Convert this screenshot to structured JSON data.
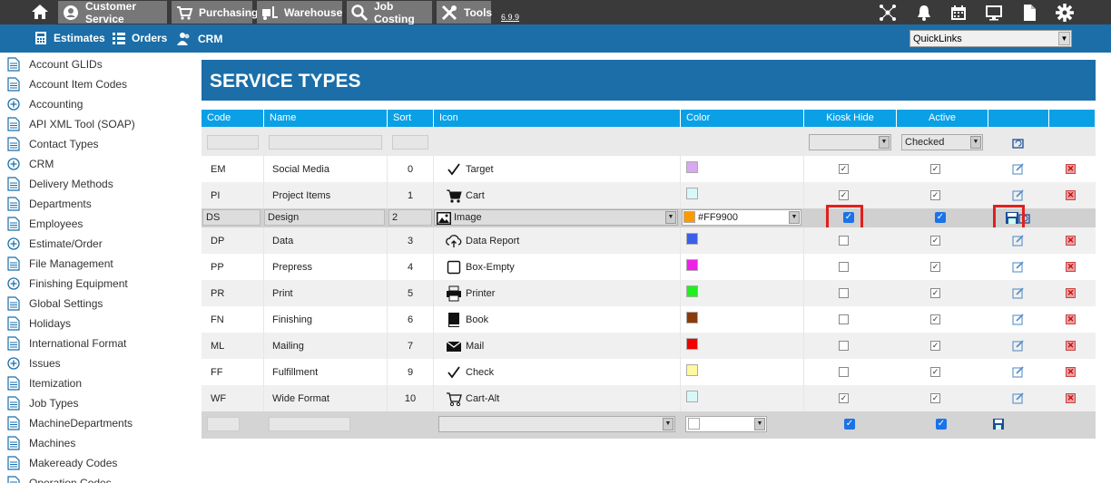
{
  "topnav": {
    "items": [
      {
        "label": "Customer Service"
      },
      {
        "label": "Purchasing"
      },
      {
        "label": "Warehouse"
      },
      {
        "label": "Job Costing"
      },
      {
        "label": "Tools"
      }
    ],
    "version": "6.9.9"
  },
  "subnav": {
    "items": [
      {
        "label": "Estimates"
      },
      {
        "label": "Orders"
      },
      {
        "label": "CRM"
      }
    ],
    "quicklinks": "QuickLinks"
  },
  "sidebar": {
    "items": [
      {
        "label": "Account GLIDs",
        "icon": "document-icon"
      },
      {
        "label": "Account Item Codes",
        "icon": "document-icon"
      },
      {
        "label": "Accounting",
        "icon": "plus-circle-icon"
      },
      {
        "label": "API XML Tool (SOAP)",
        "icon": "document-icon"
      },
      {
        "label": "Contact Types",
        "icon": "document-icon"
      },
      {
        "label": "CRM",
        "icon": "plus-circle-icon"
      },
      {
        "label": "Delivery Methods",
        "icon": "document-icon"
      },
      {
        "label": "Departments",
        "icon": "document-icon"
      },
      {
        "label": "Employees",
        "icon": "document-icon"
      },
      {
        "label": "Estimate/Order",
        "icon": "plus-circle-icon"
      },
      {
        "label": "File Management",
        "icon": "document-icon"
      },
      {
        "label": "Finishing Equipment",
        "icon": "plus-circle-icon"
      },
      {
        "label": "Global Settings",
        "icon": "document-icon"
      },
      {
        "label": "Holidays",
        "icon": "document-icon"
      },
      {
        "label": "International Format",
        "icon": "document-icon"
      },
      {
        "label": "Issues",
        "icon": "plus-circle-icon"
      },
      {
        "label": "Itemization",
        "icon": "document-icon"
      },
      {
        "label": "Job Types",
        "icon": "document-icon"
      },
      {
        "label": "MachineDepartments",
        "icon": "document-icon"
      },
      {
        "label": "Machines",
        "icon": "document-icon"
      },
      {
        "label": "Makeready Codes",
        "icon": "document-icon"
      },
      {
        "label": "Operation Codes",
        "icon": "document-icon"
      }
    ]
  },
  "page": {
    "title": "SERVICE TYPES"
  },
  "table": {
    "headers": {
      "code": "Code",
      "name": "Name",
      "sort": "Sort",
      "icon": "Icon",
      "color": "Color",
      "kiosk": "Kiosk Hide",
      "active": "Active"
    },
    "filter": {
      "active_value": "Checked"
    },
    "rows": [
      {
        "code": "EM",
        "name": "Social Media",
        "sort": "0",
        "icon": "Target",
        "color": "#d8a8f0",
        "kiosk": true,
        "active": true
      },
      {
        "code": "PI",
        "name": "Project Items",
        "sort": "1",
        "icon": "Cart",
        "color": "#d8f8f8",
        "kiosk": true,
        "active": true
      },
      {
        "code": "DS",
        "name": "Design",
        "sort": "2",
        "icon": "Image",
        "color": "#FF9900",
        "color_text": "#FF9900",
        "kiosk": true,
        "active": true,
        "editing": true
      },
      {
        "code": "DP",
        "name": "Data",
        "sort": "3",
        "icon": "Data Report",
        "color": "#3a5fe8",
        "kiosk": false,
        "active": true
      },
      {
        "code": "PP",
        "name": "Prepress",
        "sort": "4",
        "icon": "Box-Empty",
        "color": "#f020e8",
        "kiosk": false,
        "active": true
      },
      {
        "code": "PR",
        "name": "Print",
        "sort": "5",
        "icon": "Printer",
        "color": "#20f020",
        "kiosk": false,
        "active": true
      },
      {
        "code": "FN",
        "name": "Finishing",
        "sort": "6",
        "icon": "Book",
        "color": "#8b3a0a",
        "kiosk": false,
        "active": true
      },
      {
        "code": "ML",
        "name": "Mailing",
        "sort": "7",
        "icon": "Mail",
        "color": "#f00000",
        "kiosk": false,
        "active": true
      },
      {
        "code": "FF",
        "name": "Fulfillment",
        "sort": "9",
        "icon": "Check",
        "color": "#fff8a0",
        "kiosk": false,
        "active": true
      },
      {
        "code": "WF",
        "name": "Wide Format",
        "sort": "10",
        "icon": "Cart-Alt",
        "color": "#d8f8f8",
        "kiosk": true,
        "active": true
      }
    ]
  },
  "colors": {
    "accent": "#1b6ea8",
    "header": "#0aa0e6",
    "highlight": "#e0201c"
  }
}
